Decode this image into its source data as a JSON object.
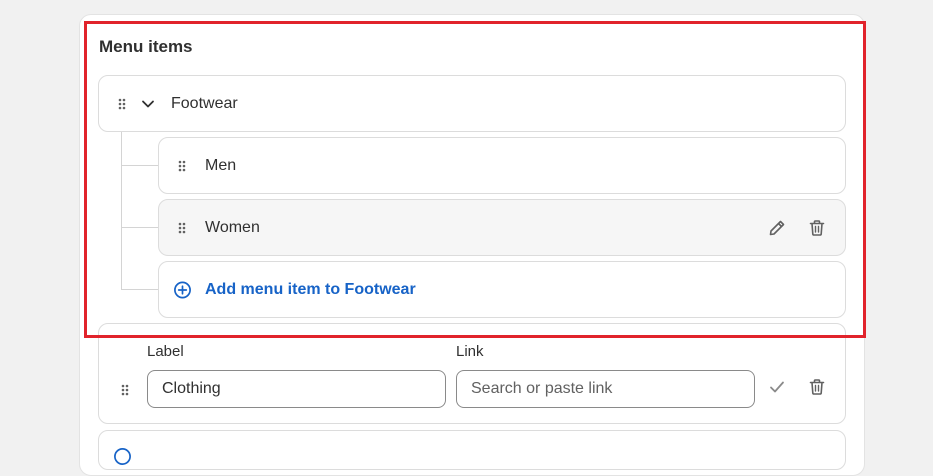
{
  "menu": {
    "title": "Menu items",
    "parent": {
      "label": "Footwear"
    },
    "children": [
      {
        "label": "Men"
      },
      {
        "label": "Women"
      }
    ],
    "add_item_label": "Add menu item to Footwear"
  },
  "edit_row": {
    "label_heading": "Label",
    "link_heading": "Link",
    "label_value": "Clothing",
    "link_placeholder": "Search or paste link"
  },
  "colors": {
    "highlight": "#e1232b",
    "link_blue": "#1763c7"
  }
}
